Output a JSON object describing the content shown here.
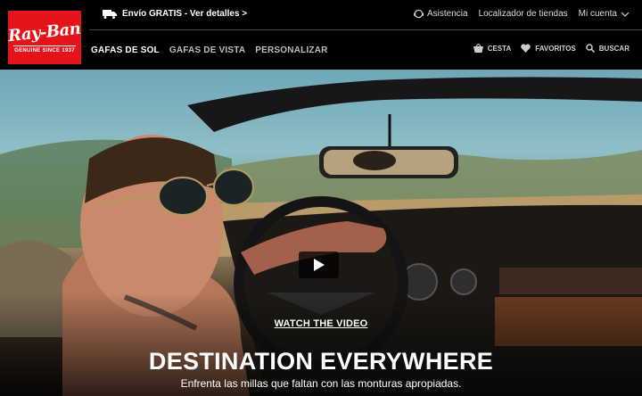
{
  "brand": {
    "logo_text": "Ray-Ban",
    "logo_tagline": "GENUINE SINCE 1937",
    "logo_color": "#e5141b"
  },
  "topbar": {
    "shipping_text": "Envío GRATIS - Ver detalles >",
    "shipping_icon": "truck-icon",
    "links": [
      {
        "label": "Asistencia",
        "icon": "support-icon"
      },
      {
        "label": "Localizador de tiendas"
      },
      {
        "label": "Mi cuenta",
        "icon": "chevron-down-icon"
      }
    ]
  },
  "nav": {
    "items": [
      {
        "label": "GAFAS DE SOL",
        "active": true
      },
      {
        "label": "GAFAS DE VISTA"
      },
      {
        "label": "PERSONALIZAR"
      }
    ],
    "actions": [
      {
        "label": "CESTA",
        "icon": "basket-icon"
      },
      {
        "label": "FAVORITOS",
        "icon": "heart-icon"
      },
      {
        "label": "BUSCAR",
        "icon": "search-icon"
      }
    ]
  },
  "hero": {
    "watch_label": "WATCH THE VIDEO",
    "headline": "DESTINATION EVERYWHERE",
    "subheadline": "Enfrenta las millas que faltan con las monturas apropiadas.",
    "play_icon": "play-icon"
  }
}
